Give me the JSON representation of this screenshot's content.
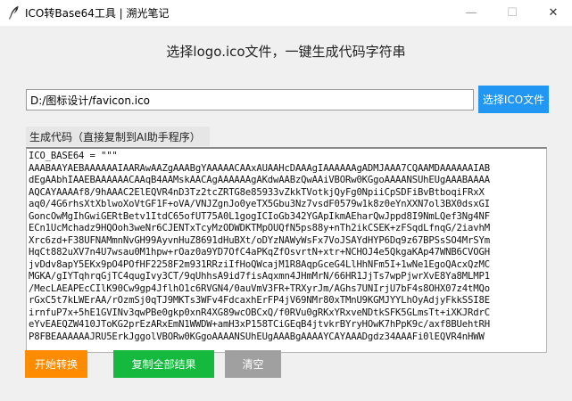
{
  "window": {
    "title": "ICO转Base64工具 | 溯光笔记",
    "minimize_glyph": "—",
    "maximize_glyph": "☐",
    "close_glyph": "✕"
  },
  "header": {
    "title": "选择logo.ico文件，一键生成代码字符串"
  },
  "file": {
    "path_value": "D:/图标设计/favicon.ico",
    "select_button_label": "选择ICO文件"
  },
  "output": {
    "section_label": "生成代码（直接复制到AI助手程序）",
    "lines": [
      "ICO_BASE64 = \"\"\"",
      "AAABAAYAEBAAAAAAIAARAwAAZgAAABgYAAAAACAAxAUAAHcDAAAgIAAAAAAgADMJAAA7CQAAMDAAAAAAIAB",
      "dEgAAbhIAAEBAAAAAACAAqB4AAMskAACAgAAAAAAgAKdwAABzQwAAiVBORw0KGgoAAAANSUhEUgAAABAAAA",
      "AQCAYAAAAf8/9hAAAC2ElEQVR4nD3Tz2tcZRTG8e85933vZkkTVotkjQyFg0NpiiCpSDFiBvBtboqiFRxX",
      "aq0/4G6rhsXtXblwoXoVtGF1F+oVA/VNJZgnJo0yeTX5Gbu3Nz7vsdF0579w1k8z0eYnXXN7ol3BX0dsxGI",
      "GoncOwMgIhGwiGERtBetv1ItdC65ofUT75A0L1gogICIoGb342YGApIkmAEharQwJppd8I9NmLQef3Ng4NF",
      "ECn1UcMchadz9HQOoh3weNr6CJENTxTcyMzODWDKTMpOUQfN5ps88y+nTh2ikCSEK+zFSqdLfnqG/2iavhM",
      "Xrc6zd+F38UFNAMmnNvGH99AyvnHuZ8691dHuBXt/oDYzNAWyWsFx7VoJSAYdHYP6Dq9z67BPSsSO4MrSYm",
      "HqCt882uXV7n4U7wsau0M1hpw+rOaz0a9YD7OfC4aPKqZfOsvrtN+xtr+NCHOJ4e5QkgaKAp47WNB6CVOGH",
      "jvDdv8apY5EKx9pO4POfHF2258F2m931RRziIfHoQWcajM1R8AqpGceG4LlHhNFm5I+1wNe1EgoQAcxQzMC",
      "MGKA/gIYTqhrqGjTC4qugIvy3CT/9qUhhsA9id7fisAqxmn4JHmMrN/66HR1JjTs7wpPjwrXvE8Ya8MLMP1",
      "/MecLAEAPEcCIlK90Cw9gp4JflhO1c6RVGN4/0auVmV3FR+TRXyrJm/AGhs7UNIrjU7bF4s8OHX07z4tMQo",
      "rGxC5t7kLWErAA/rOzmSj0qTJ9MKTs3WFv4FdcaxhErFP4jV69NMr80xTMnU9KGMJYYLhOyAdjyFkkSSI8E",
      "irnfuP7x+5hE1GVINv3qwPBe0gkp0xnR4XG89wcOBCxQ/f0RVu0gRKxYRxveNDtkSFK5GLmsTt+iXKJRdrC",
      "eYvEAEQZW410JToKG2prEzARxEmN1WWDW+amH3xP158TCiGEqB4jtvkrBYryHOwK7hPpK9c/axf8BUehtRH",
      "P8FBEAAAAAAJRU5ErkJggolVBORw0KGgoAAAANSUhEUgAAABgAAAAYCAYAAADgdz34AAAFi0lEQVR4nHWW"
    ]
  },
  "actions": {
    "start_label": "开始转换",
    "copy_label": "复制全部结果",
    "clear_label": "清空"
  },
  "colors": {
    "select_button": "#2196f3",
    "start_button": "#ff8c00",
    "copy_button": "#14b93e",
    "clear_button": "#a0a0a0"
  }
}
